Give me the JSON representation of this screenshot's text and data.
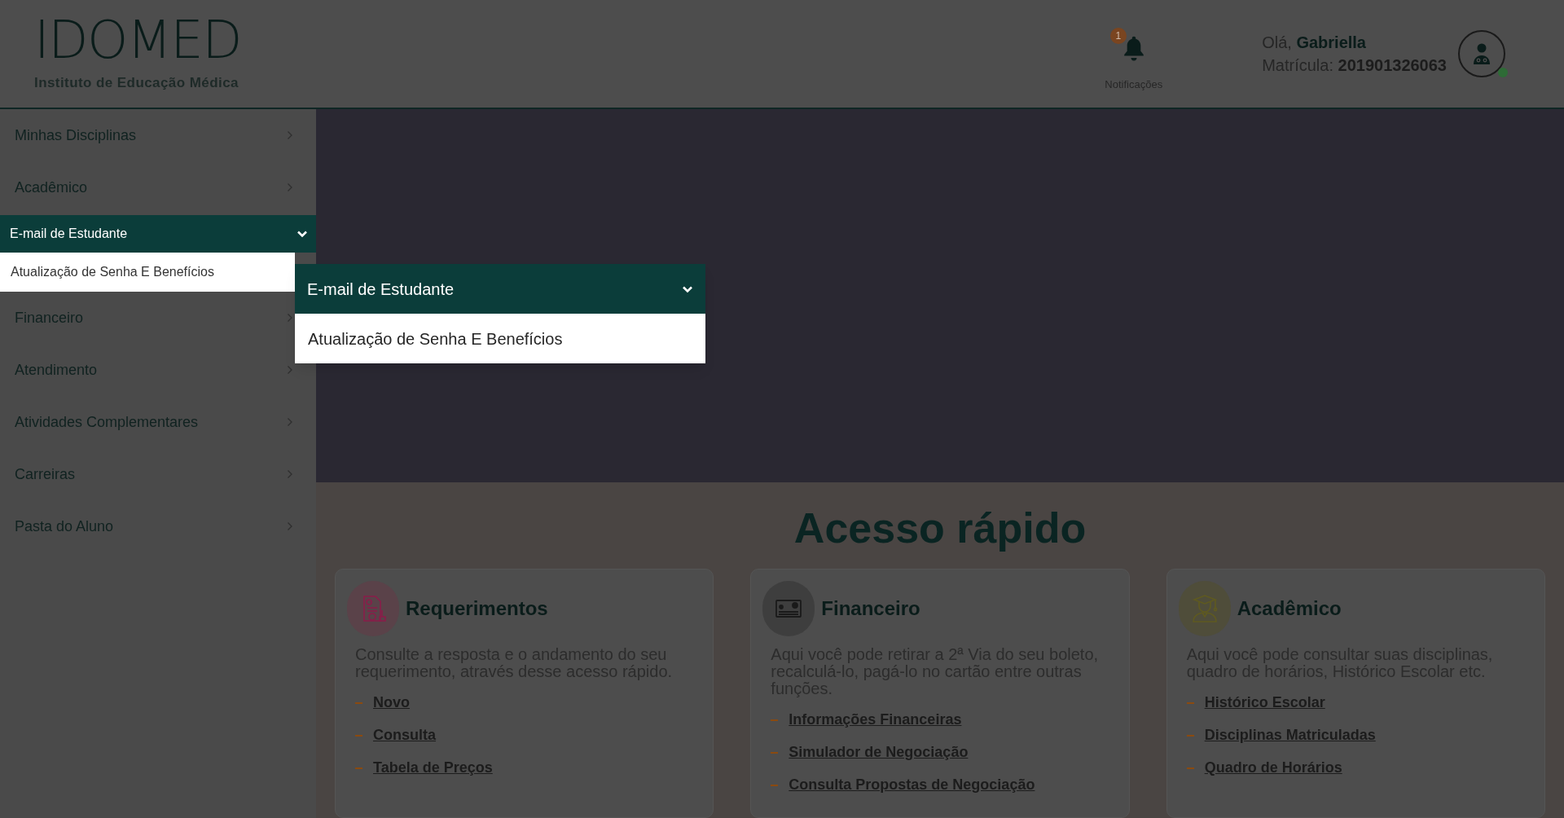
{
  "header": {
    "logo": {
      "title": "IDOMED",
      "subtitle": "Instituto de Educação Médica"
    },
    "notifications": {
      "badge": "1",
      "label": "Notificações"
    },
    "user": {
      "greeting": "Olá,",
      "name": "Gabriella",
      "id_label": "Matrícula:",
      "id": "201901326063",
      "online": true
    }
  },
  "sidebar": {
    "items": [
      {
        "label": "Minhas Disciplinas",
        "expanded": false
      },
      {
        "label": "Acadêmico",
        "expanded": false
      },
      {
        "label": "E-mail de Estudante",
        "expanded": true,
        "children": [
          {
            "label": "Atualização de Senha E Benefícios"
          }
        ]
      },
      {
        "label": "Financeiro",
        "expanded": false
      },
      {
        "label": "Atendimento",
        "expanded": false
      },
      {
        "label": "Atividades Complementares",
        "expanded": false
      },
      {
        "label": "Carreiras",
        "expanded": false
      },
      {
        "label": "Pasta do Aluno",
        "expanded": false
      }
    ]
  },
  "popup": {
    "title": "E-mail de Estudante",
    "items": [
      "Atualização de Senha E Benefícios"
    ]
  },
  "quick_access": {
    "title": "Acesso rápido",
    "cards": [
      {
        "kind": "requests",
        "title": "Requerimentos",
        "description": "Consulte a resposta e o andamento do seu requerimento, através desse acesso rápido.",
        "links": [
          "Novo",
          "Consulta",
          "Tabela de Preços"
        ]
      },
      {
        "kind": "finance",
        "title": "Financeiro",
        "description": "Aqui você pode retirar a 2ª Via do seu boleto, recalculá-lo, pagá-lo no cartão entre outras funções.",
        "links": [
          "Informações Financeiras",
          "Simulador de Negociação",
          "Consulta Propostas de Negociação"
        ]
      },
      {
        "kind": "academic",
        "title": "Acadêmico",
        "description": "Aqui você pode consultar suas disciplinas, quadro de horários, Histórico Escolar etc.",
        "links": [
          "Histórico Escolar",
          "Disciplinas Matriculadas",
          "Quadro de Horários"
        ]
      }
    ]
  }
}
